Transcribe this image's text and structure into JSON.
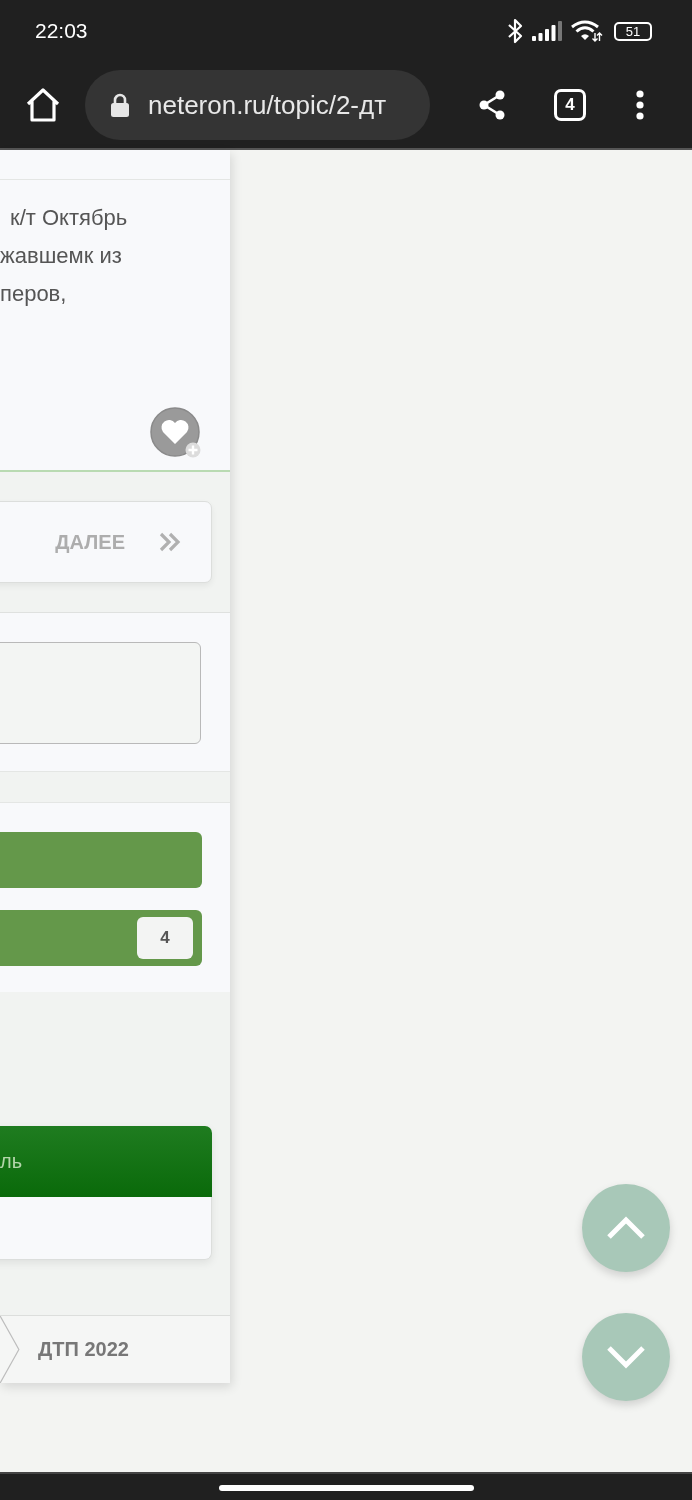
{
  "status_bar": {
    "time": "22:03",
    "battery": "51"
  },
  "browser": {
    "url": "neteron.ru/topic/2-дт",
    "tab_count": "4"
  },
  "post": {
    "lines": [
      "к/т Октябрь",
      "жавшемк из",
      "перов,"
    ]
  },
  "pager": {
    "next": "ДАЛЕЕ"
  },
  "action_bars": [
    {
      "kind": "plain"
    },
    {
      "kind": "counter",
      "count": "4"
    }
  ],
  "panel": {
    "title": "ль"
  },
  "breadcrumb": [
    {
      "label": "ДТП 2022"
    }
  ]
}
